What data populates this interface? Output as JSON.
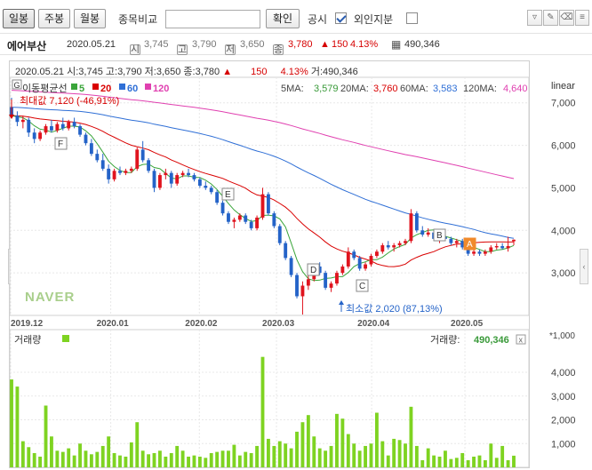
{
  "toolbar": {
    "period_buttons": [
      "일봉",
      "주봉",
      "월봉"
    ],
    "compare_label": "종목비교",
    "compare_placeholder": "",
    "confirm_label": "확인",
    "notice_label": "공시",
    "foreign_label": "외인지분"
  },
  "info": {
    "name": "에어부산",
    "date": "2020.05.21",
    "open": "3,745",
    "high": "3,790",
    "low": "3,650",
    "close": "3,780",
    "change": "150",
    "change_pct": "4.13%",
    "volume": "490,346",
    "icon_open": "시",
    "icon_high": "고",
    "icon_low": "저",
    "icon_close": "종"
  },
  "dataline": {
    "date": "2020.05.21",
    "open": "시:3,745",
    "high": "고:3,790",
    "low": "저:3,650",
    "close": "종:3,780",
    "change": "150",
    "change_pct": "4.13%",
    "volume": "거:490,346"
  },
  "legend": {
    "g_label": "G",
    "title": "이동평균선",
    "ma": [
      {
        "label": "5",
        "color": "#3aa53a"
      },
      {
        "label": "20",
        "color": "#d90000"
      },
      {
        "label": "60",
        "color": "#2f6fd6"
      },
      {
        "label": "120",
        "color": "#e040b0"
      }
    ],
    "ma_values": [
      {
        "name": "5MA:",
        "value": "3,579",
        "color": "#3a9a3a"
      },
      {
        "name": "20MA:",
        "value": "3,760",
        "color": "#d90000"
      },
      {
        "name": "60MA:",
        "value": "3,583",
        "color": "#2f6fd6"
      },
      {
        "name": "120MA:",
        "value": "4,640",
        "color": "#e040b0"
      }
    ],
    "scale_label": "linear"
  },
  "annotations": {
    "max_label": "최대값 7,120 (-46,91%)",
    "min_label": "최소값 2,020 (87,13%)",
    "markers": [
      "F",
      "E",
      "D",
      "C",
      "B",
      "A"
    ],
    "brand": "NAVER"
  },
  "volume_panel": {
    "title": "거래량",
    "value_label": "거래량:",
    "value": "490,346",
    "unit": "*1,000",
    "close_icon": "x"
  },
  "colors": {
    "up": "#e0141e",
    "down": "#2463c8",
    "volume": "#7ed321",
    "ma5": "#3aa53a",
    "ma20": "#d90000",
    "ma60": "#2f6fd6",
    "ma120": "#e040b0"
  },
  "chart_data": [
    {
      "type": "candlestick",
      "title": "에어부산",
      "x_ticks": [
        "2019.12",
        "2020.01",
        "2020.02",
        "2020.03",
        "2020.04",
        "2020.05"
      ],
      "y_ticks": [
        3000,
        4000,
        5000,
        6000,
        7000
      ],
      "ylim": [
        2000,
        7600
      ],
      "scale": "linear",
      "ohlc": [
        [
          6900,
          7120,
          6650,
          6700
        ],
        [
          6700,
          6800,
          6450,
          6550
        ],
        [
          6550,
          6700,
          6400,
          6600
        ],
        [
          6600,
          6650,
          6200,
          6300
        ],
        [
          6300,
          6400,
          6050,
          6150
        ],
        [
          6150,
          6350,
          6100,
          6300
        ],
        [
          6300,
          6500,
          6250,
          6450
        ],
        [
          6450,
          6600,
          6300,
          6350
        ],
        [
          6350,
          6550,
          6300,
          6500
        ],
        [
          6500,
          6650,
          6350,
          6400
        ],
        [
          6400,
          6600,
          6350,
          6550
        ],
        [
          6550,
          6650,
          6400,
          6450
        ],
        [
          6450,
          6500,
          6200,
          6250
        ],
        [
          6250,
          6300,
          6000,
          6050
        ],
        [
          6050,
          6150,
          5750,
          5800
        ],
        [
          5800,
          5900,
          5600,
          5650
        ],
        [
          5650,
          5800,
          5400,
          5450
        ],
        [
          5450,
          5550,
          5100,
          5200
        ],
        [
          5200,
          5450,
          5150,
          5400
        ],
        [
          5400,
          5500,
          5300,
          5350
        ],
        [
          5350,
          5450,
          5300,
          5400
        ],
        [
          5400,
          5500,
          5350,
          5450
        ],
        [
          5450,
          5950,
          5400,
          5900
        ],
        [
          5900,
          6100,
          5600,
          5650
        ],
        [
          5650,
          5700,
          5350,
          5400
        ],
        [
          5400,
          5450,
          4900,
          5000
        ],
        [
          5000,
          5350,
          4950,
          5300
        ],
        [
          5300,
          5450,
          5200,
          5350
        ],
        [
          5350,
          5400,
          5000,
          5100
        ],
        [
          5100,
          5350,
          5050,
          5300
        ],
        [
          5300,
          5400,
          5250,
          5350
        ],
        [
          5350,
          5450,
          5250,
          5300
        ],
        [
          5300,
          5350,
          5150,
          5200
        ],
        [
          5200,
          5250,
          5000,
          5050
        ],
        [
          5050,
          5150,
          4950,
          5000
        ],
        [
          5000,
          5050,
          4850,
          4900
        ],
        [
          4900,
          4950,
          4600,
          4650
        ],
        [
          4650,
          4700,
          4350,
          4400
        ],
        [
          4400,
          4450,
          4150,
          4200
        ],
        [
          4200,
          4300,
          4050,
          4250
        ],
        [
          4250,
          4400,
          4200,
          4350
        ],
        [
          4350,
          4400,
          4150,
          4200
        ],
        [
          4200,
          4250,
          4000,
          4050
        ],
        [
          4050,
          4350,
          4000,
          4300
        ],
        [
          4300,
          5000,
          4250,
          4850
        ],
        [
          4850,
          4900,
          4350,
          4400
        ],
        [
          4400,
          4450,
          4050,
          4100
        ],
        [
          4100,
          4150,
          3650,
          3700
        ],
        [
          3700,
          3750,
          3300,
          3350
        ],
        [
          3350,
          3400,
          2900,
          2950
        ],
        [
          2950,
          3000,
          2400,
          2450
        ],
        [
          2450,
          2800,
          2020,
          2700
        ],
        [
          2700,
          2950,
          2600,
          2850
        ],
        [
          2850,
          3200,
          2800,
          3150
        ],
        [
          3150,
          3250,
          2950,
          3000
        ],
        [
          3000,
          3050,
          2600,
          2650
        ],
        [
          2650,
          2800,
          2550,
          2750
        ],
        [
          2750,
          3050,
          2700,
          3000
        ],
        [
          3000,
          3200,
          2950,
          3150
        ],
        [
          3150,
          3600,
          3100,
          3500
        ],
        [
          3500,
          3550,
          3300,
          3350
        ],
        [
          3350,
          3400,
          3050,
          3100
        ],
        [
          3100,
          3250,
          3050,
          3200
        ],
        [
          3200,
          3450,
          3150,
          3400
        ],
        [
          3400,
          3550,
          3350,
          3500
        ],
        [
          3500,
          3700,
          3450,
          3650
        ],
        [
          3650,
          3750,
          3550,
          3600
        ],
        [
          3600,
          3700,
          3500,
          3650
        ],
        [
          3650,
          3750,
          3600,
          3700
        ],
        [
          3700,
          3800,
          3650,
          3750
        ],
        [
          3750,
          4500,
          3700,
          4400
        ],
        [
          4400,
          4450,
          3950,
          4000
        ],
        [
          4000,
          4100,
          3850,
          3900
        ],
        [
          3900,
          4050,
          3850,
          3950
        ],
        [
          3950,
          4000,
          3750,
          3800
        ],
        [
          3800,
          3900,
          3700,
          3850
        ],
        [
          3850,
          3950,
          3750,
          3800
        ],
        [
          3800,
          3850,
          3650,
          3700
        ],
        [
          3700,
          3800,
          3600,
          3750
        ],
        [
          3750,
          3800,
          3550,
          3600
        ],
        [
          3600,
          3650,
          3400,
          3450
        ],
        [
          3450,
          3550,
          3400,
          3500
        ],
        [
          3500,
          3550,
          3400,
          3450
        ],
        [
          3450,
          3550,
          3400,
          3500
        ],
        [
          3500,
          3650,
          3450,
          3600
        ],
        [
          3600,
          3700,
          3550,
          3630
        ],
        [
          3630,
          3700,
          3550,
          3580
        ],
        [
          3580,
          3850,
          3500,
          3630
        ],
        [
          3745,
          3790,
          3650,
          3780
        ]
      ]
    },
    {
      "type": "bar",
      "title": "거래량",
      "y_ticks": [
        1000,
        2000,
        3000,
        4000
      ],
      "ylim": [
        0,
        4900
      ],
      "unit": "*1,000",
      "values": [
        3700,
        3400,
        1100,
        850,
        600,
        450,
        2600,
        1300,
        700,
        650,
        800,
        500,
        1000,
        700,
        550,
        650,
        900,
        1300,
        600,
        500,
        450,
        1050,
        1900,
        700,
        550,
        600,
        700,
        450,
        600,
        900,
        700,
        450,
        500,
        450,
        400,
        600,
        650,
        700,
        700,
        950,
        500,
        650,
        600,
        900,
        4650,
        1200,
        900,
        1100,
        1000,
        800,
        1500,
        1900,
        2200,
        1300,
        800,
        700,
        900,
        2250,
        2050,
        1400,
        1000,
        700,
        900,
        1000,
        2300,
        1100,
        500,
        1200,
        1150,
        1000,
        2550,
        900,
        300,
        800,
        500,
        450,
        700,
        350,
        400,
        600,
        300,
        450,
        500,
        300,
        1000,
        400,
        900,
        300,
        490
      ]
    }
  ]
}
